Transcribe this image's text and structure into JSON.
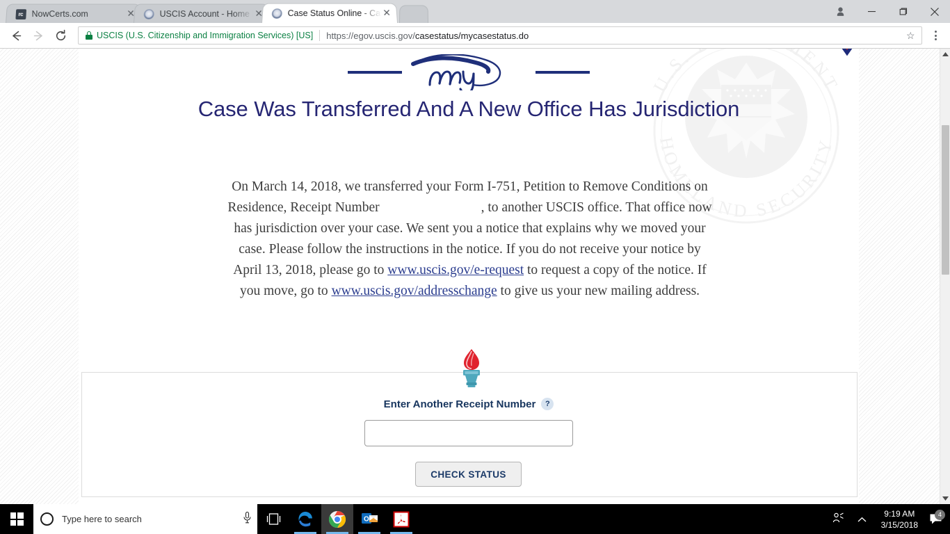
{
  "browser": {
    "tabs": [
      {
        "title": "NowCerts.com",
        "favicon": "nowcerts-favicon",
        "active": false,
        "close_label": "✕"
      },
      {
        "title": "USCIS Account - Home P",
        "favicon": "uscis-seal-favicon",
        "active": false,
        "close_label": "✕"
      },
      {
        "title": "Case Status Online - Case",
        "favicon": "uscis-seal-favicon",
        "active": true,
        "close_label": "✕"
      }
    ],
    "window_controls": {
      "minimize": "─",
      "maximize": "❐",
      "close": "✕"
    },
    "nav": {
      "back": "←",
      "forward": "→",
      "reload": "⟳"
    },
    "omnibox": {
      "security_label": "USCIS (U.S. Citizenship and Immigration Services) [US]",
      "url_prefix": "https://egov.uscis.gov/",
      "url_rest": "casestatus/mycasestatus.do",
      "bookmark_star": "☆"
    }
  },
  "page": {
    "logo_text": "my",
    "title": "Case Was Transferred And A New Office Has Jurisdiction",
    "body": {
      "segment_1": "On March 14, 2018, we transferred your Form I-751, Petition to Remove Conditions on Residence, Receipt Number",
      "segment_2": ", to another USCIS office. That office now has jurisdiction over your case. We sent you a notice that explains why we moved your case. Please follow the instructions in the notice. If you do not receive your notice by April 13, 2018, please go to ",
      "link_1": "www.uscis.gov/e-request",
      "segment_3": " to request a copy of the notice. If you move, go to ",
      "link_2": "www.uscis.gov/addresschange",
      "segment_4": " to give us your new mailing address."
    },
    "form": {
      "label": "Enter Another Receipt Number",
      "help_glyph": "?",
      "receipt_value": "",
      "receipt_placeholder": "",
      "submit_label": "CHECK STATUS"
    },
    "watermark": "U.S. DEPARTMENT OF HOMELAND SECURITY"
  },
  "taskbar": {
    "search_placeholder": "Type here to search",
    "apps": [
      {
        "name": "task-view",
        "running": false
      },
      {
        "name": "microsoft-edge",
        "running": true
      },
      {
        "name": "google-chrome",
        "running": true
      },
      {
        "name": "microsoft-outlook",
        "running": true
      },
      {
        "name": "adobe-acrobat-reader",
        "running": true
      }
    ],
    "tray": {
      "people_glyph": "☻",
      "chevron_glyph": "∧"
    },
    "clock_time": "9:19 AM",
    "clock_date": "3/15/2018",
    "notification_count": "4"
  },
  "colors": {
    "heading_navy": "#262673",
    "link_blue": "#2b3d8f",
    "label_navy": "#17355e",
    "secure_green": "#0b8043",
    "torch_flame_red": "#e0232e",
    "torch_base_teal": "#4fa8bd"
  }
}
